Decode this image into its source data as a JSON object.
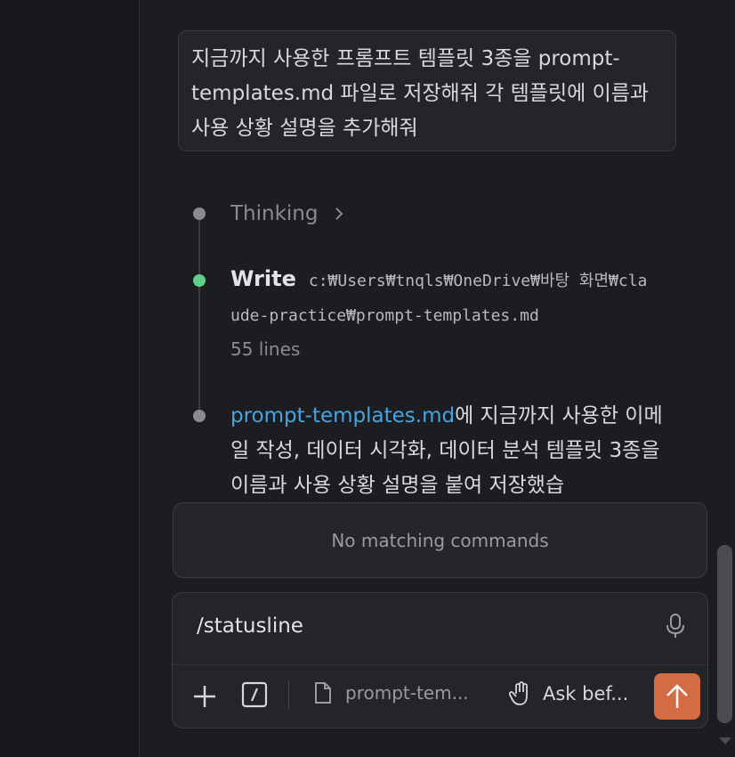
{
  "user_message": "지금까지 사용한 프롬프트 템플릿 3종을 prompt-templates.md 파일로 저장해줘 각 템플릿에 이름과 사용 상황 설명을 추가해줘",
  "timeline": {
    "thinking_label": "Thinking",
    "write_label": "Write",
    "write_path_part1": "c:₩Users₩tnqls₩OneDrive₩바탕 화면₩cla",
    "write_path_part2": "ude-practice₩prompt-templates.md",
    "write_lines": "55 lines",
    "assistant_link": "prompt-templates.md",
    "assistant_text": "에 지금까지 사용한 이메일 작성, 데이터 시각화, 데이터 분석 템플릿 3종을 이름과 사용 상황 설명을 붙여 저장했습"
  },
  "command_popup": {
    "message": "No matching commands"
  },
  "input": {
    "value": "/statusline"
  },
  "toolbar": {
    "file_label": "prompt-tem...",
    "mode_label": "Ask bef..."
  },
  "icons": {
    "thinking_expand": "chevron-right-icon",
    "mic": "microphone-icon",
    "plus": "plus-icon",
    "slash": "slash-command-icon",
    "file": "file-icon",
    "mode": "hand-icon",
    "send": "arrow-up-icon"
  },
  "colors": {
    "accent_send": "#d36b45",
    "link": "#4aa3e0",
    "status_done": "#5fcf8a"
  }
}
